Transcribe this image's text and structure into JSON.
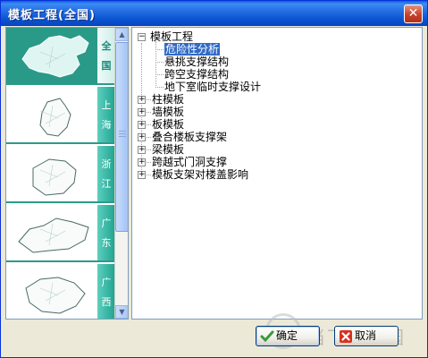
{
  "window": {
    "title": "模板工程(全国)",
    "close_glyph": "✕"
  },
  "regions": [
    {
      "name": "全国",
      "chars": [
        "全",
        "国"
      ],
      "selected": true
    },
    {
      "name": "上海",
      "chars": [
        "上",
        "海"
      ],
      "selected": false
    },
    {
      "name": "浙江",
      "chars": [
        "浙",
        "江"
      ],
      "selected": false
    },
    {
      "name": "广东",
      "chars": [
        "广",
        "东"
      ],
      "selected": false
    },
    {
      "name": "广西",
      "chars": [
        "广",
        "西"
      ],
      "selected": false
    }
  ],
  "tree": {
    "root": "模板工程",
    "root_children": [
      "危险性分析",
      "悬挑支撑结构",
      "跨空支撑结构",
      "地下室临时支撑设计"
    ],
    "groups": [
      "柱模板",
      "墙模板",
      "板模板",
      "叠合楼板支撑架",
      "梁模板",
      "跨越式门洞支撑",
      "模板支架对楼盖影响"
    ],
    "selected": "危险性分析",
    "expander_collapsed": "+",
    "expander_expanded": "−"
  },
  "buttons": {
    "ok": {
      "label": "确定",
      "icon": "check-icon",
      "color": "#3a9a3a"
    },
    "cancel": {
      "label": "取消",
      "icon": "x-icon",
      "color": "#d83020"
    }
  },
  "watermark": {
    "text": "当下软件园"
  },
  "scroll": {
    "up": "▲",
    "down": "▼"
  },
  "colors": {
    "accent": "#1fa38f",
    "selection": "#316ac5",
    "title_bar": "#0a55d0"
  }
}
